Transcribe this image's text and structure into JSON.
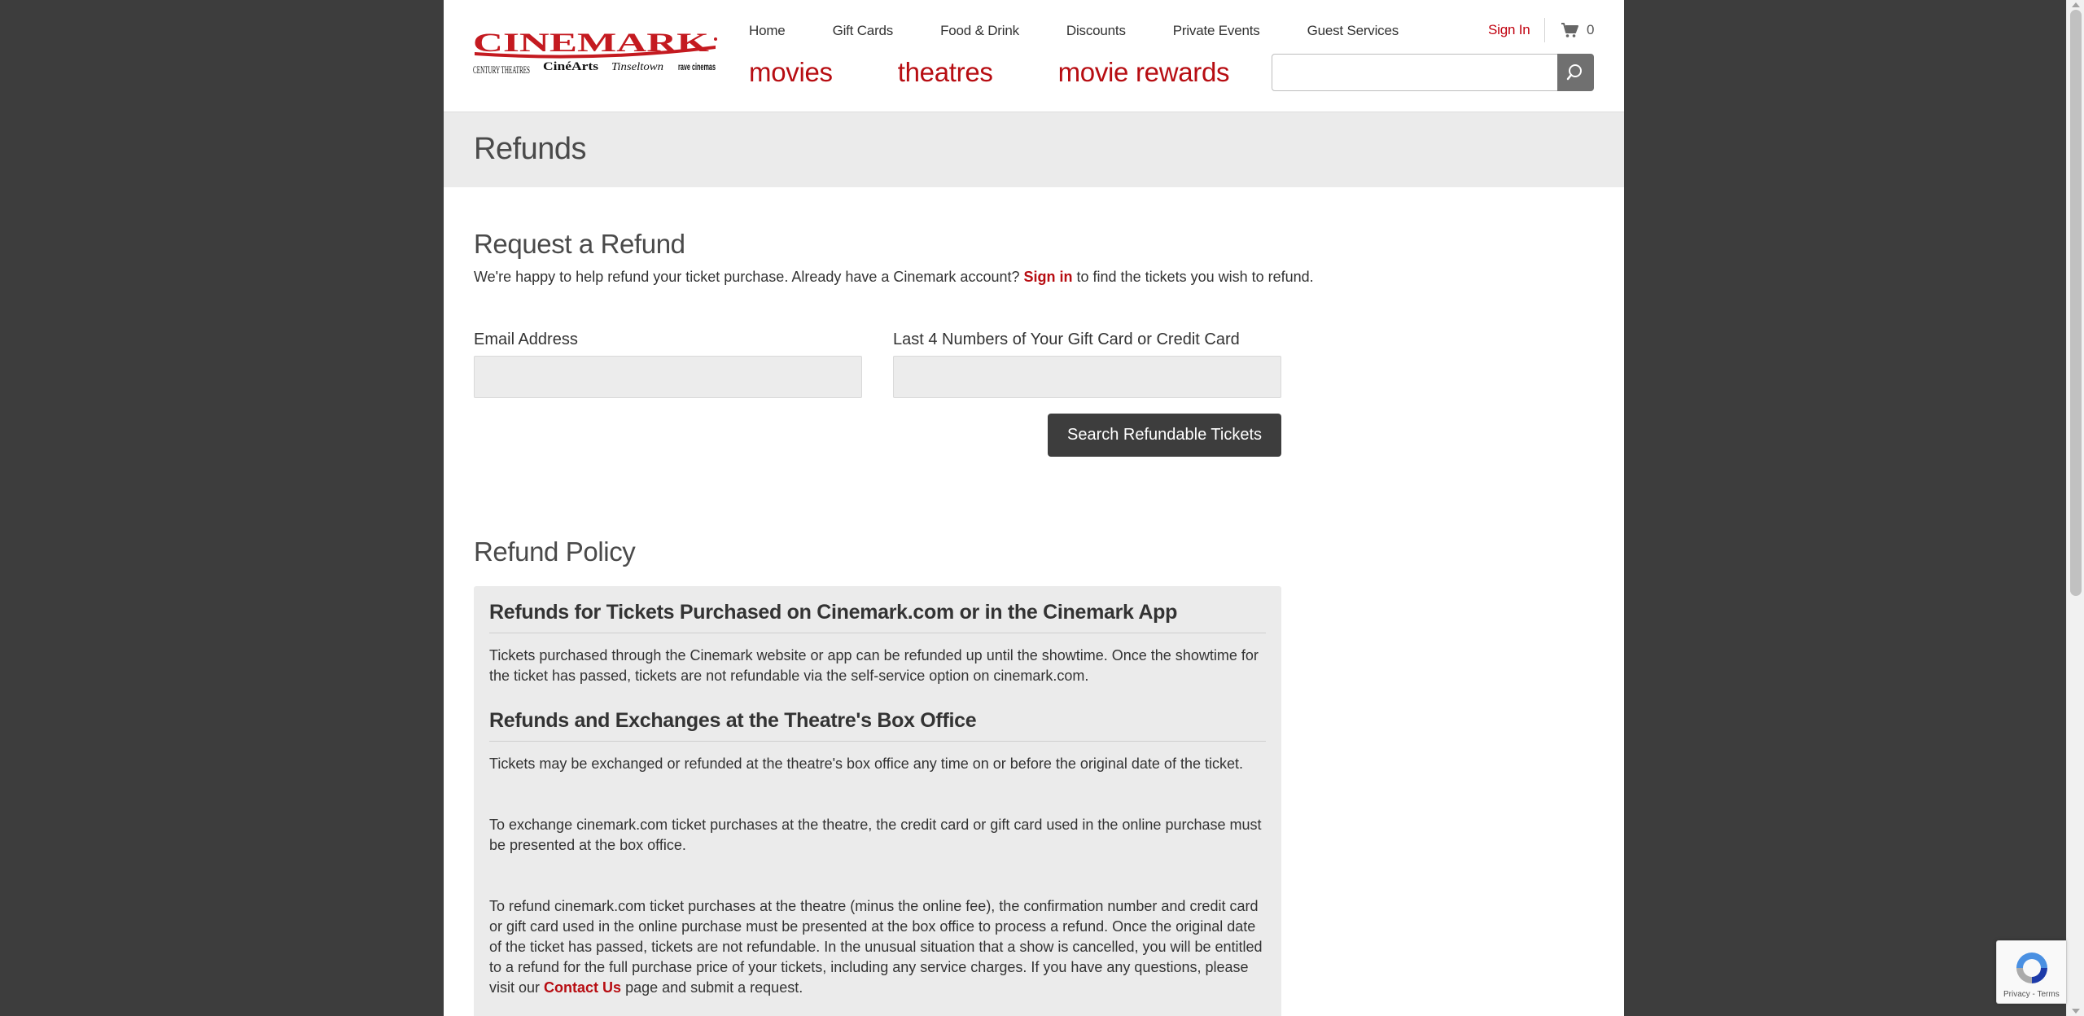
{
  "header": {
    "logo": {
      "brand": "CINEMARK",
      "sub_brands": [
        "CENTURY THEATRES",
        "CinéArts",
        "Tinseltown",
        "rave cinemas"
      ]
    },
    "util_nav": [
      "Home",
      "Gift Cards",
      "Food & Drink",
      "Discounts",
      "Private Events",
      "Guest Services"
    ],
    "sign_in": "Sign In",
    "cart_count": "0",
    "main_nav": [
      "movies",
      "theatres",
      "movie rewards"
    ],
    "search": {
      "placeholder": "",
      "value": ""
    }
  },
  "page_title": "Refunds",
  "request": {
    "heading": "Request a Refund",
    "intro_before": "We're happy to help refund your ticket purchase. Already have a Cinemark account?",
    "intro_link": "Sign in",
    "intro_after": "to find the tickets you wish to refund.",
    "email_label": "Email Address",
    "card_label": "Last 4 Numbers of Your Gift Card or Credit Card",
    "email_value": "",
    "card_value": "",
    "submit_label": "Search Refundable Tickets"
  },
  "policy": {
    "heading": "Refund Policy",
    "online_heading": "Refunds for Tickets Purchased on Cinemark.com or in the Cinemark App",
    "online_text": "Tickets purchased through the Cinemark website or app can be refunded up until the showtime. Once the showtime for the ticket has passed, tickets are not refundable via the self-service option on cinemark.com.",
    "box_heading": "Refunds and Exchanges at the Theatre's Box Office",
    "box_text_1": "Tickets may be exchanged or refunded at the theatre's box office any time on or before the original date of the ticket.",
    "box_text_2": "To exchange cinemark.com ticket purchases at the theatre, the credit card or gift card used in the online purchase must be presented at the box office.",
    "box_text_3": "To refund cinemark.com ticket purchases at the theatre (minus the online fee), the confirmation number and credit card or gift card used in the online purchase must be presented at the box office to process a refund. Once the original date of the ticket has passed, tickets are not refundable. In the unusual situation that a show is cancelled, you will be entitled to a refund for the full purchase price of your tickets, including any service charges. If you have any questions, please visit our",
    "contact_link": "Contact Us",
    "box_text_3_after": "page and submit a request."
  },
  "recaptcha": {
    "links": "Privacy - Terms"
  },
  "colors": {
    "brand_red": "#b70d12",
    "background": "#3d3d3d",
    "band": "#ebebeb",
    "button": "#3d3d3d"
  }
}
